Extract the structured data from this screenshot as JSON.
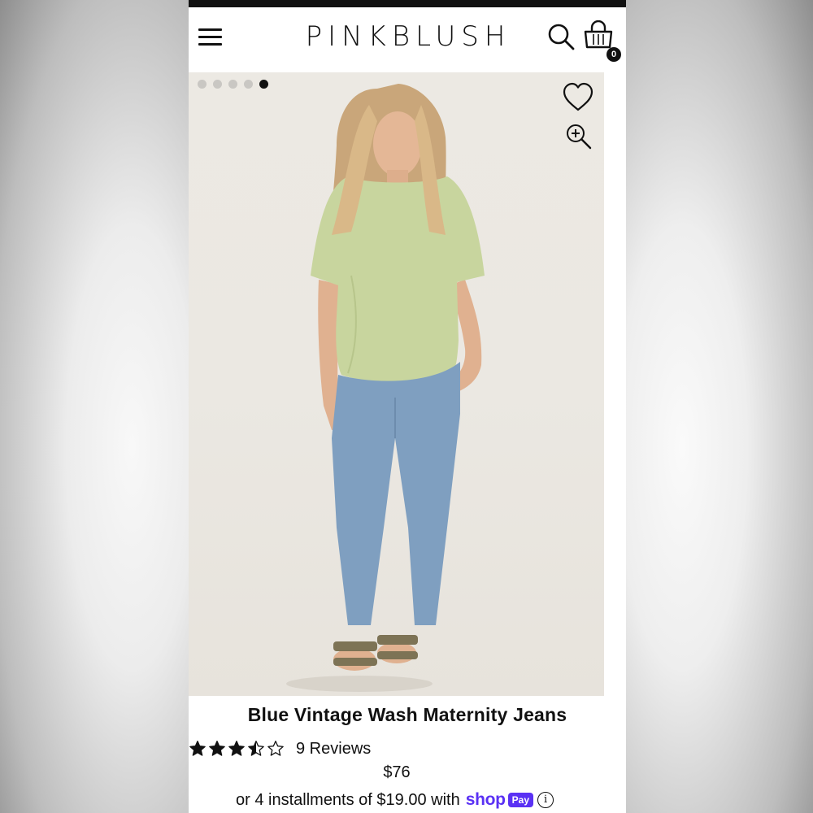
{
  "header": {
    "logo": "PINKBLUSH",
    "cart_count": "0"
  },
  "gallery": {
    "total_images": 5,
    "active_index": 4
  },
  "product": {
    "title": "Blue Vintage Wash Maternity Jeans",
    "rating": 3.5,
    "max_rating": 5,
    "reviews_label": "9 Reviews",
    "price": "$76",
    "installments_text": "or 4 installments of $19.00 with",
    "shop_brand": "shop",
    "pay_badge": "Pay",
    "info_glyph": "i"
  },
  "colors": {
    "text": "#111111",
    "shop_pay": "#5a31f4",
    "top": "#c8d59e",
    "jeans": "#7f9fc0"
  },
  "icons": [
    "menu-icon",
    "search-icon",
    "shopping-bag-icon",
    "heart-icon",
    "zoom-in-icon",
    "star-icon",
    "info-icon"
  ]
}
